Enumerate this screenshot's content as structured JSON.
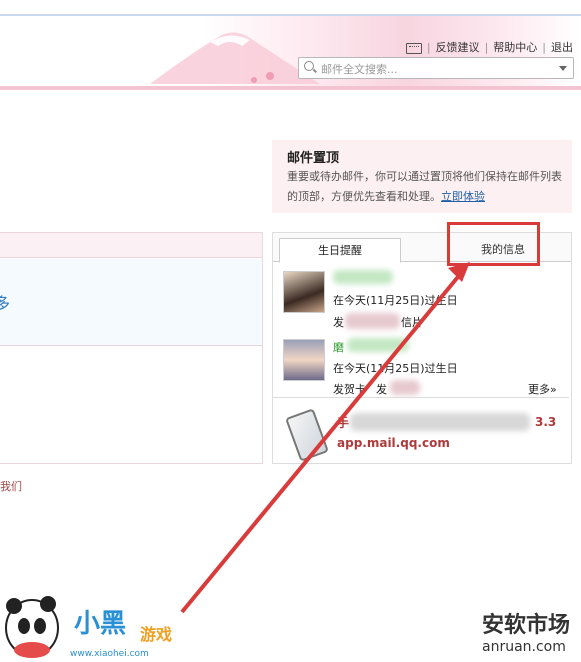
{
  "header": {
    "links": [
      "反馈建议",
      "帮助中心",
      "退出"
    ],
    "search_placeholder": "邮件全文搜索..."
  },
  "pin_tip": {
    "title": "邮件置顶",
    "desc": "重要或待办邮件，你可以通过置顶将他们保持在邮件列表的顶部，方便优先查看和处理。",
    "link": "立即体验"
  },
  "tabs": [
    "生日提醒",
    "我的信息"
  ],
  "birthdays": [
    {
      "text": "在今天(11月25日)过生日",
      "action_prefix": "发",
      "action_suffix": "信片"
    },
    {
      "name_prefix": "磨",
      "text": "在今天(11月25日)过生日",
      "action_prefix": "发贺卡",
      "action_suffix": "发"
    }
  ],
  "more": "更多»",
  "app": {
    "url": "app.mail.qq.com",
    "version_prefix": "手",
    "version": "3.3"
  },
  "left_fragments": {
    "link_char": "多",
    "footer": "我们"
  },
  "watermarks": {
    "left_url": "www.xiaohei.com",
    "right_top": "安软市场",
    "right_bottom": "anruan.com"
  },
  "colors": {
    "accent_red": "#d93b3b",
    "link_blue": "#1f5fa6",
    "header_pink": "#f8d5e0"
  }
}
